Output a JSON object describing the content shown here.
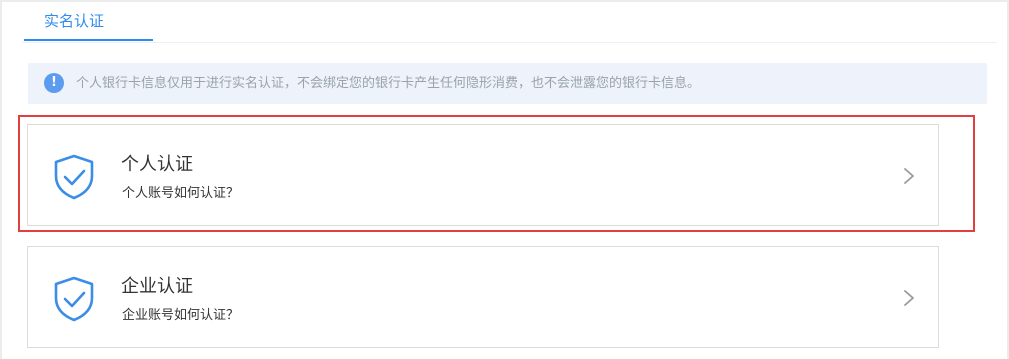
{
  "tabs": [
    {
      "label": "实名认证",
      "active": true
    }
  ],
  "notice": {
    "icon": "info-icon",
    "icon_glyph": "!",
    "text": "个人银行卡信息仅用于进行实名认证，不会绑定您的银行卡产生任何隐形消费，也不会泄露您的银行卡信息。"
  },
  "cards": [
    {
      "id": "personal",
      "icon": "shield-check-icon",
      "title": "个人认证",
      "subtitle": "个人账号如何认证？",
      "highlighted": true
    },
    {
      "id": "company",
      "icon": "shield-check-icon",
      "title": "企业认证",
      "subtitle": "企业账号如何认证？",
      "highlighted": false
    }
  ],
  "colors": {
    "accent": "#2d8cf0",
    "notice_bg": "#edf2fb",
    "highlight": "#e0403f",
    "icon_blue": "#3a8ee6"
  }
}
